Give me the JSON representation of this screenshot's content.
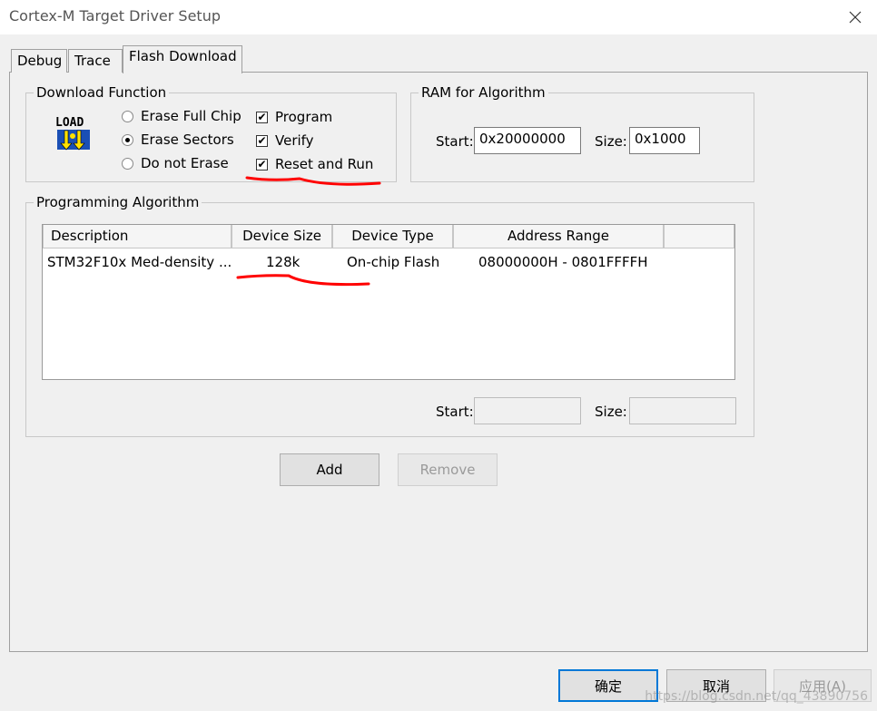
{
  "window": {
    "title": "Cortex-M Target Driver Setup"
  },
  "tabs": [
    {
      "label": "Debug"
    },
    {
      "label": "Trace"
    },
    {
      "label": "Flash Download"
    }
  ],
  "download_function": {
    "legend": "Download Function",
    "logo_text": "LOAD",
    "erase_options": [
      {
        "label": "Erase Full Chip",
        "selected": false
      },
      {
        "label": "Erase Sectors",
        "selected": true
      },
      {
        "label": "Do not Erase",
        "selected": false
      }
    ],
    "checks": [
      {
        "label": "Program",
        "checked": true
      },
      {
        "label": "Verify",
        "checked": true
      },
      {
        "label": "Reset and Run",
        "checked": true
      }
    ]
  },
  "ram": {
    "legend": "RAM for Algorithm",
    "start_label": "Start:",
    "start_value": "0x20000000",
    "size_label": "Size:",
    "size_value": "0x1000"
  },
  "algorithm": {
    "legend": "Programming Algorithm",
    "columns": [
      "Description",
      "Device Size",
      "Device Type",
      "Address Range"
    ],
    "rows": [
      {
        "description": "STM32F10x Med-density ...",
        "device_size": "128k",
        "device_type": "On-chip Flash",
        "address_range": "08000000H - 0801FFFFH"
      }
    ],
    "start_label": "Start:",
    "start_value": "",
    "size_label": "Size:",
    "size_value": ""
  },
  "buttons": {
    "add": "Add",
    "remove": "Remove"
  },
  "footer": {
    "ok": "确定",
    "cancel": "取消",
    "apply": "应用(A)"
  },
  "watermark": "https://blog.csdn.net/qq_43890756",
  "colors": {
    "annotation": "#ff0000",
    "focus_border": "#0078d7"
  },
  "icons": {
    "close": "close-icon",
    "load": "load-icon"
  }
}
